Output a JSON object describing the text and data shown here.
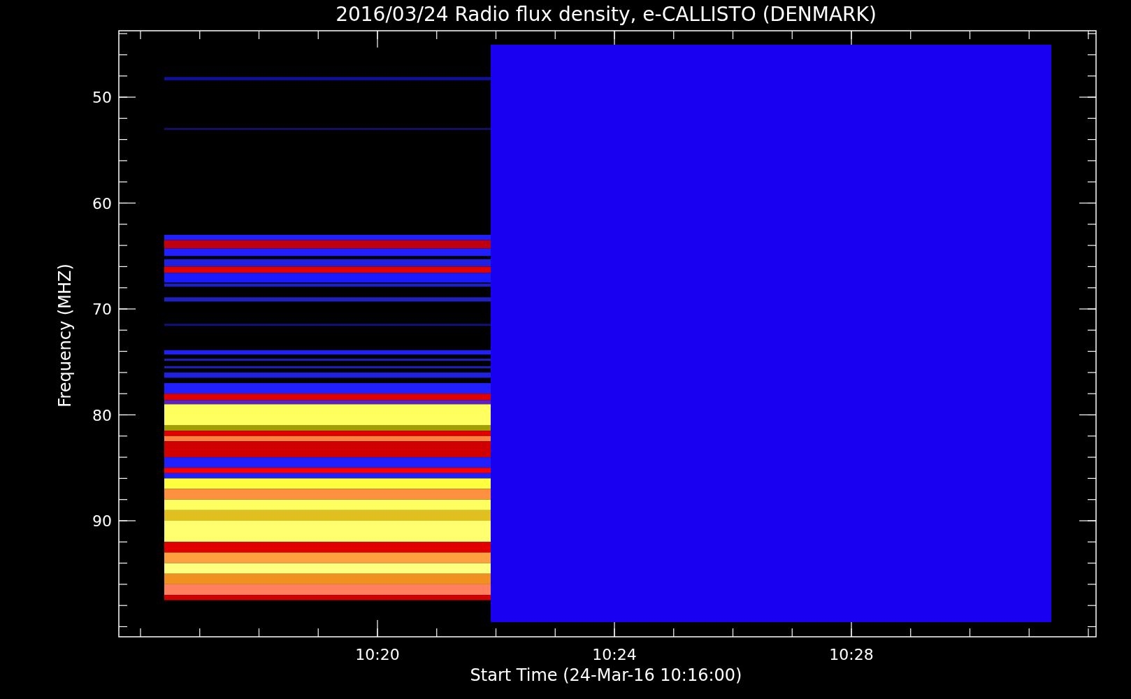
{
  "title": "2016/03/24  Radio flux density, e-CALLISTO (DENMARK)",
  "y_axis": {
    "label": "Frequency (MHZ)",
    "ticks": [
      "50",
      "60",
      "70",
      "80",
      "90"
    ]
  },
  "x_axis": {
    "label": "Start Time (24-Mar-16 10:16:00)",
    "ticks": [
      "10:20",
      "10:24",
      "10:28"
    ]
  }
}
